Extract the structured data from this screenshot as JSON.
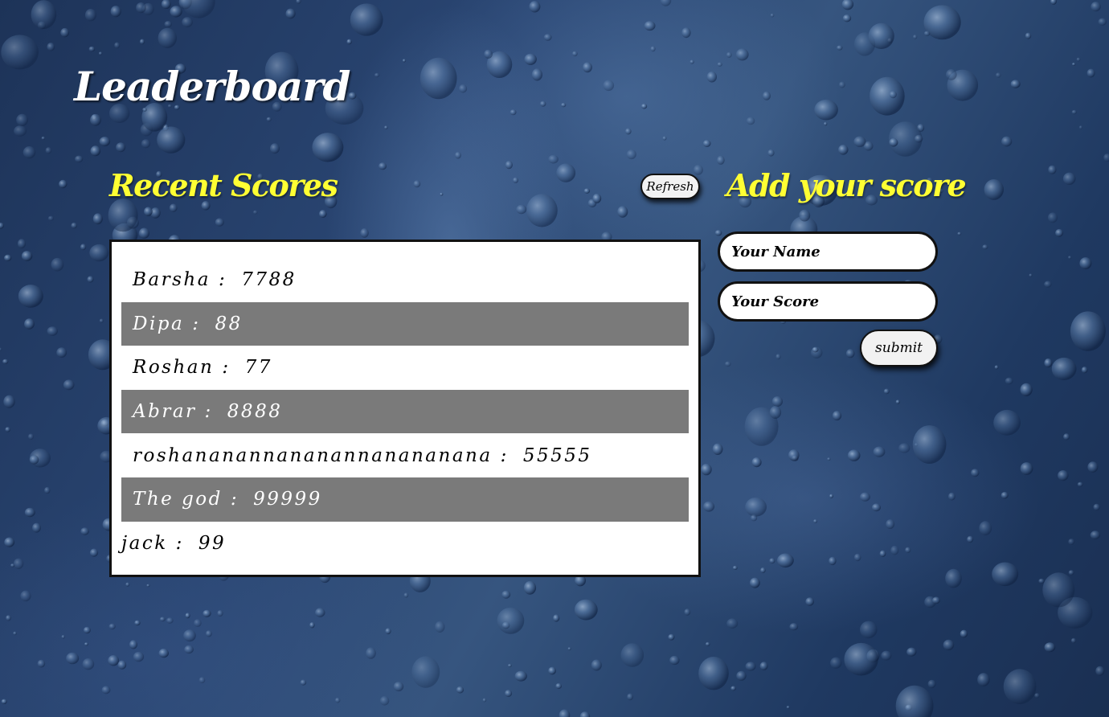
{
  "page": {
    "title": "Leaderboard",
    "background": "water-droplets-blue",
    "colors": {
      "heading_accent": "#ffff33",
      "title": "#ffffff",
      "row_alt": "#7a7a7a"
    }
  },
  "recent": {
    "heading": "Recent Scores",
    "refresh_label": "Refresh",
    "separator": ":",
    "scores": [
      {
        "name": "Barsha",
        "score": "7788"
      },
      {
        "name": "Dipa",
        "score": "88"
      },
      {
        "name": "Roshan",
        "score": "77"
      },
      {
        "name": "Abrar",
        "score": "8888"
      },
      {
        "name": "roshananannananannanananana",
        "score": "55555"
      },
      {
        "name": "The god",
        "score": "99999"
      },
      {
        "name": "jack",
        "score": "99"
      }
    ]
  },
  "form": {
    "heading": "Add your score",
    "name_placeholder": "Your Name",
    "name_value": "",
    "score_placeholder": "Your Score",
    "score_value": "",
    "submit_label": "submit"
  }
}
